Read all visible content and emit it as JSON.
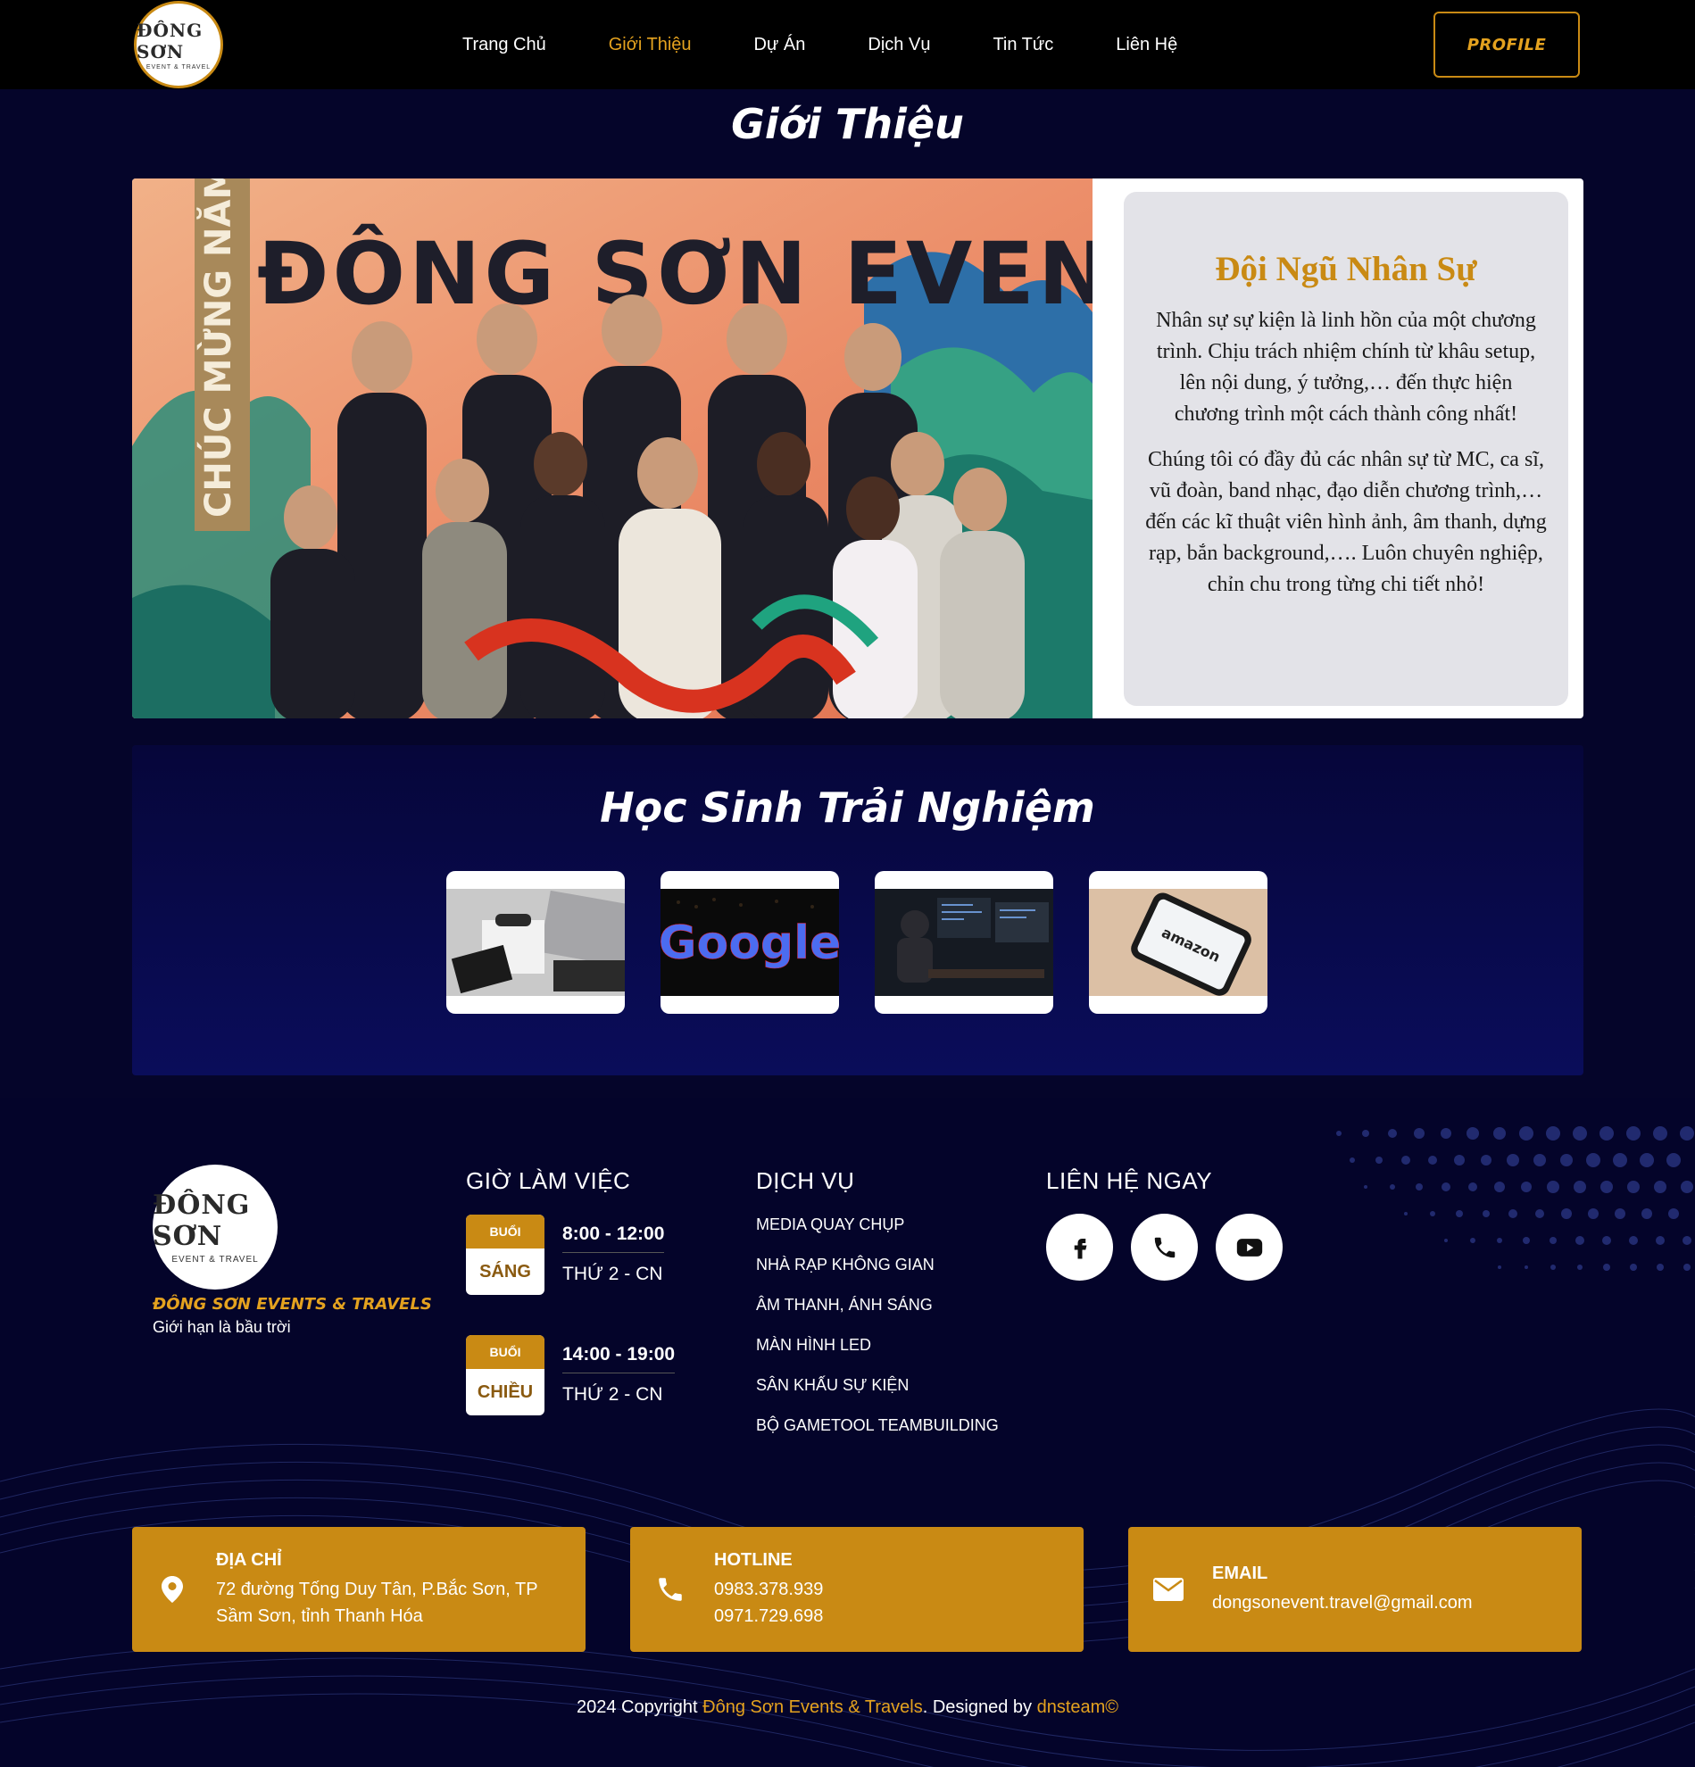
{
  "nav": {
    "logo_main": "ĐÔNG SƠN",
    "logo_sub": "EVENT & TRAVEL",
    "items": [
      "Trang Chủ",
      "Giới Thiệu",
      "Dự Án",
      "Dịch Vụ",
      "Tin Tức",
      "Liên Hệ"
    ],
    "active_index": 1,
    "profile_label": "PROFILE"
  },
  "about": {
    "title": "Giới Thiệu",
    "banner_headline": "ĐÔNG SƠN EVENT",
    "banner_vertical": "CHÚC MỪNG NĂM MỚI",
    "card_title": "Đội Ngũ Nhân Sự",
    "paragraph_1": "Nhân sự sự kiện là linh hồn của một chương trình. Chịu trách nhiệm chính từ khâu setup, lên nội dung, ý tưởng,… đến thực hiện chương trình một cách thành công nhất!",
    "paragraph_2": "Chúng tôi có đầy đủ các nhân sự từ MC, ca sĩ, vũ đoàn, band nhạc, đạo diễn chương trình,… đến các kĩ thuật viên hình ảnh, âm thanh, dựng rạp, bắn background,…. Luôn chuyên nghiệp, chỉn chu trong từng chi tiết nhỏ!"
  },
  "students": {
    "title": "Học Sinh Trải Nghiệm",
    "thumb_google_text": "Google",
    "thumb_amazon_text": "amazon"
  },
  "footer": {
    "brand": "ĐÔNG SƠN EVENTS & TRAVELS",
    "slogan": "Giới hạn là bầu trời",
    "hours_heading": "GIỜ LÀM VIỆC",
    "shifts": [
      {
        "badge_top": "BUỔI",
        "badge_bottom": "SÁNG",
        "time": "8:00 - 12:00",
        "days": "THỨ 2 - CN"
      },
      {
        "badge_top": "BUỔI",
        "badge_bottom": "CHIỀU",
        "time": "14:00 - 19:00",
        "days": "THỨ 2 - CN"
      }
    ],
    "services_heading": "DỊCH VỤ",
    "services": [
      "MEDIA QUAY CHỤP",
      "NHÀ RẠP KHÔNG GIAN",
      "ÂM THANH, ÁNH SÁNG",
      "MÀN HÌNH LED",
      "SÂN KHẤU SỰ KIỆN",
      "BỘ GAMETOOL TEAMBUILDING"
    ],
    "contact_heading": "LIÊN HỆ NGAY",
    "socials": [
      "facebook-icon",
      "phone-icon",
      "youtube-icon"
    ],
    "address_label": "ĐỊA CHỈ",
    "address_line1": "72 đường Tống Duy Tân, P.Bắc Sơn, TP",
    "address_line2": "Sầm Sơn, tỉnh Thanh Hóa",
    "hotline_label": "HOTLINE",
    "hotline_1": "0983.378.939",
    "hotline_2": "0971.729.698",
    "email_label": "EMAIL",
    "email": "dongsonevent.travel@gmail.com",
    "copyright_prefix": "2024 Copyright ",
    "copyright_brand": "Đông Sơn Events & Travels",
    "copyright_mid": ". Designed by ",
    "copyright_team": "dnsteam©"
  },
  "colors": {
    "accent": "#c98a14",
    "accent_text": "#e4a21f",
    "background": "#05052a",
    "nav": "#000000"
  }
}
